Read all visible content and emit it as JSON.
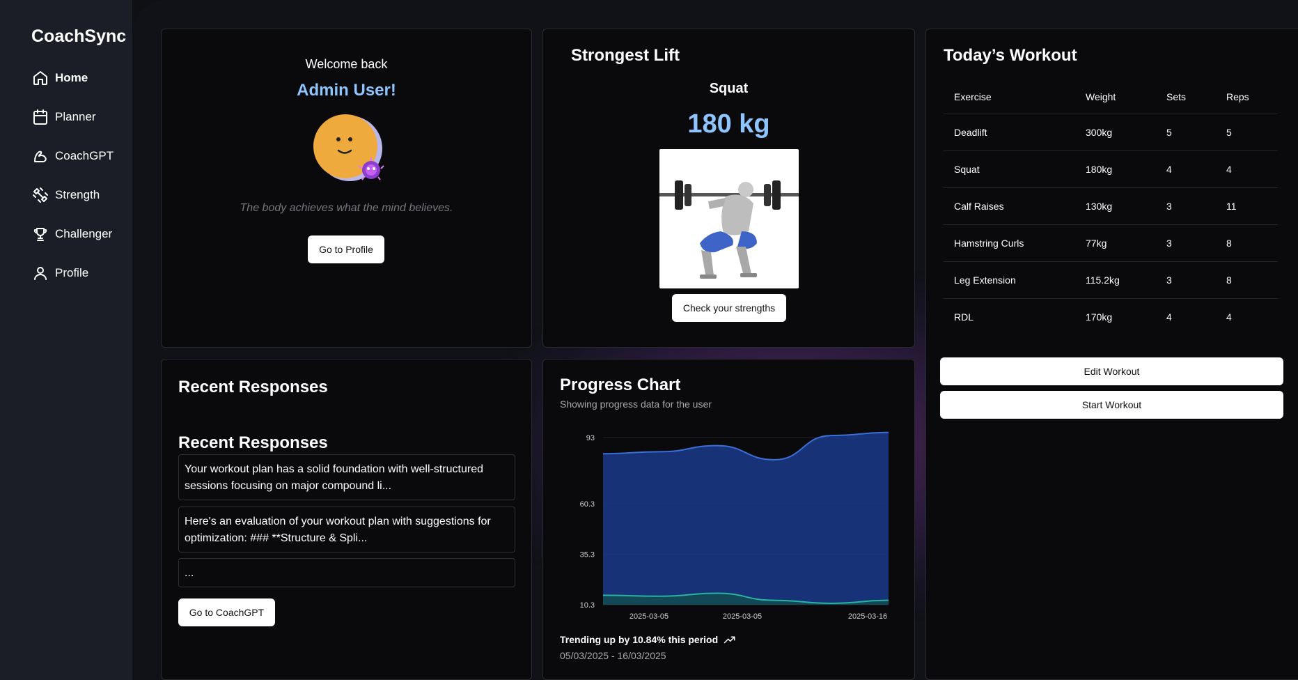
{
  "sidebar": {
    "brand": "CoachSync",
    "items": [
      {
        "label": "Home",
        "icon": "home-icon"
      },
      {
        "label": "Planner",
        "icon": "calendar-icon"
      },
      {
        "label": "CoachGPT",
        "icon": "bicep-icon"
      },
      {
        "label": "Strength",
        "icon": "dumbbell-icon"
      },
      {
        "label": "Challenger",
        "icon": "trophy-icon"
      },
      {
        "label": "Profile",
        "icon": "user-icon"
      }
    ]
  },
  "welcome": {
    "greeting": "Welcome back",
    "name": "Admin User!",
    "quote": "The body achieves what the mind believes.",
    "profile_button": "Go to Profile"
  },
  "strongest_lift": {
    "title": "Strongest Lift",
    "exercise": "Squat",
    "weight": "180 kg",
    "button": "Check your strengths"
  },
  "workout": {
    "title": "Today’s Workout",
    "headers": [
      "Exercise",
      "Weight",
      "Sets",
      "Reps"
    ],
    "rows": [
      [
        "Deadlift",
        "300kg",
        "5",
        "5"
      ],
      [
        "Squat",
        "180kg",
        "4",
        "4"
      ],
      [
        "Calf Raises",
        "130kg",
        "3",
        "11"
      ],
      [
        "Hamstring Curls",
        "77kg",
        "3",
        "8"
      ],
      [
        "Leg Extension",
        "115.2kg",
        "3",
        "8"
      ],
      [
        "RDL",
        "170kg",
        "4",
        "4"
      ]
    ],
    "edit_button": "Edit Workout",
    "start_button": "Start Workout"
  },
  "responses": {
    "title": "Recent Responses",
    "subtitle": "Recent Responses",
    "items": [
      "Your workout plan has a solid foundation with well-structured sessions focusing on major compound li...",
      "Here's an evaluation of your workout plan with suggestions for optimization: ### **Structure & Spli...",
      "..."
    ],
    "button": "Go to CoachGPT"
  },
  "progress": {
    "title": "Progress Chart",
    "subtitle": "Showing progress data for the user",
    "trend": "Trending up by 10.84% this period",
    "range": "05/03/2025 - 16/03/2025"
  },
  "chart_data": {
    "type": "area",
    "x": [
      "2025-03-05",
      "2025-03-05",
      "2025-03-05",
      "2025-03-05",
      "2025-03-12",
      "2025-03-16"
    ],
    "x_tick_labels": [
      "2025-03-05",
      "2025-03-05",
      "2025-03-16"
    ],
    "y_ticks": [
      10.3,
      35.3,
      60.3,
      93
    ],
    "ylim": [
      10.3,
      93
    ],
    "series": [
      {
        "values": [
          85,
          86,
          89,
          82,
          94,
          95.5
        ],
        "color": "#3b6fd8",
        "fill": "#1a3a8a"
      },
      {
        "values": [
          15,
          14.5,
          16,
          12.5,
          11,
          12.5
        ],
        "color": "#2ab3a0",
        "fill": "#134c52"
      }
    ],
    "grid": true,
    "legend": "none"
  },
  "colors": {
    "accent": "#8ec5ff",
    "background": "#111217",
    "card": "#0a0a0c"
  }
}
